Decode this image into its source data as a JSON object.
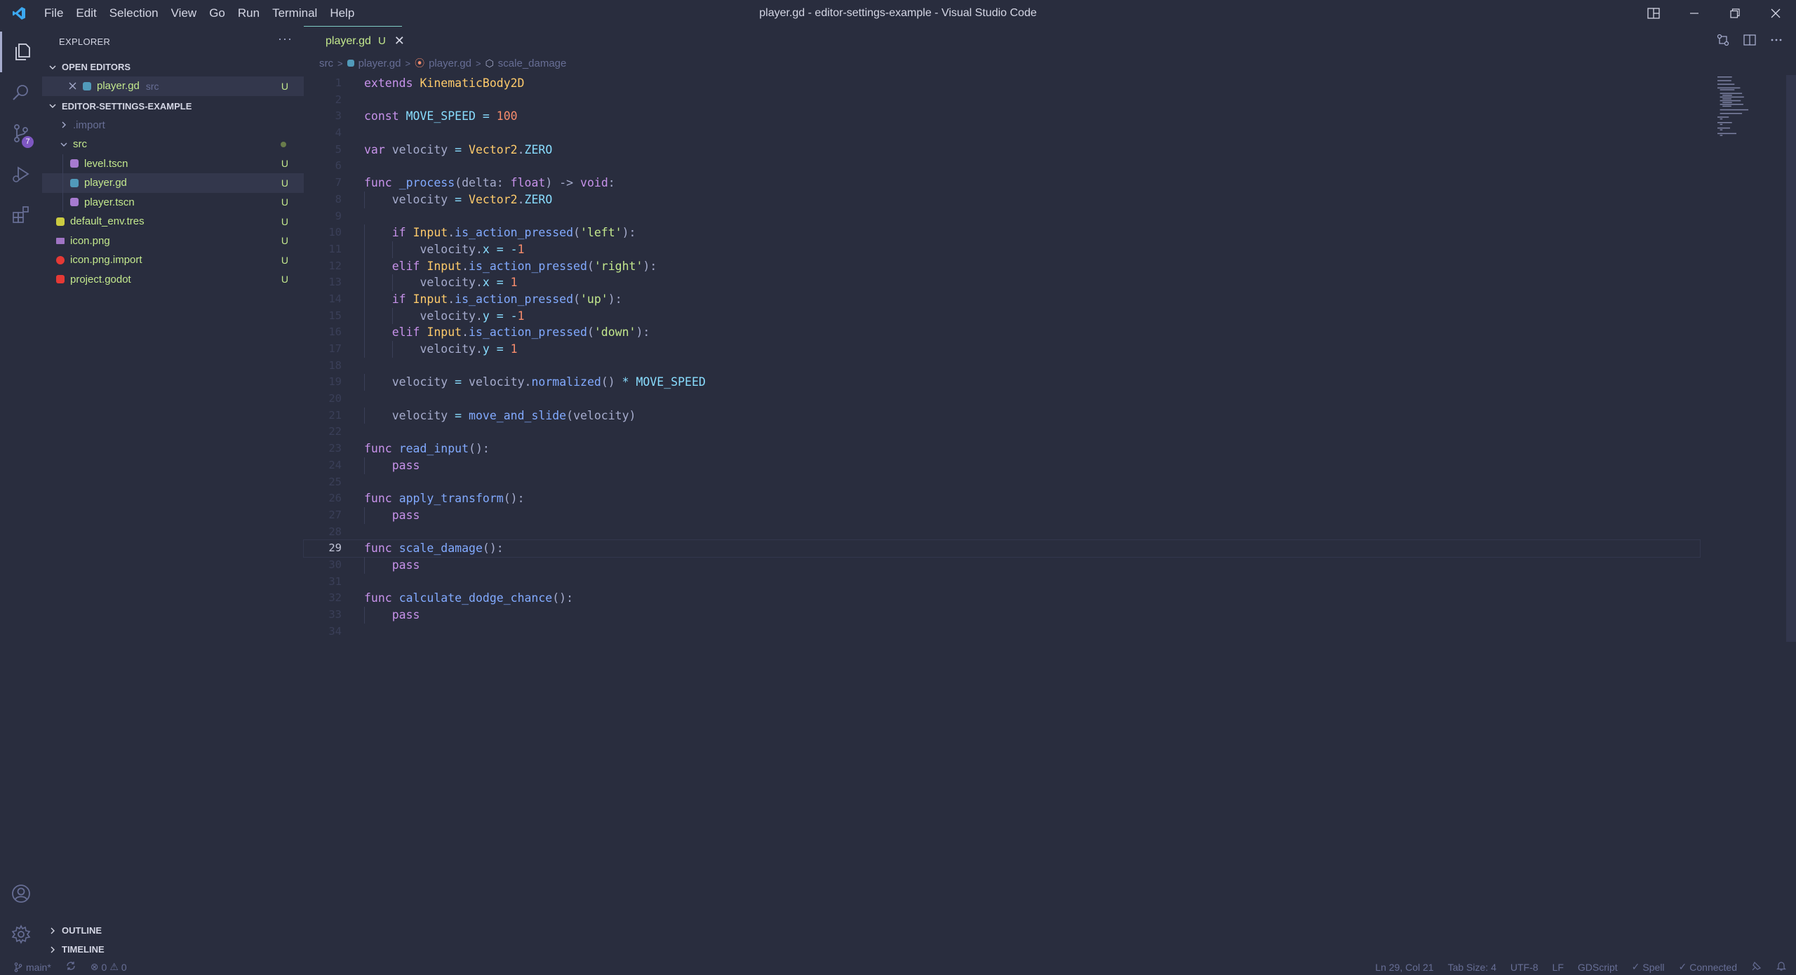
{
  "window": {
    "title": "player.gd - editor-settings-example - Visual Studio Code",
    "menu": [
      "File",
      "Edit",
      "Selection",
      "View",
      "Go",
      "Run",
      "Terminal",
      "Help"
    ]
  },
  "activity": {
    "scm_badge": "7"
  },
  "sidebar": {
    "title": "EXPLORER",
    "more": "···",
    "open_editors_label": "OPEN EDITORS",
    "open_editor": {
      "name": "player.gd",
      "path": "src",
      "status": "U"
    },
    "folder_label": "EDITOR-SETTINGS-EXAMPLE",
    "tree": [
      {
        "name": ".import",
        "type": "folder",
        "status": ""
      },
      {
        "name": "src",
        "type": "folder",
        "status": ""
      },
      {
        "name": "level.tscn",
        "type": "file",
        "status": "U"
      },
      {
        "name": "player.gd",
        "type": "file",
        "status": "U"
      },
      {
        "name": "player.tscn",
        "type": "file",
        "status": "U"
      },
      {
        "name": "default_env.tres",
        "type": "file",
        "status": "U"
      },
      {
        "name": "icon.png",
        "type": "file",
        "status": "U"
      },
      {
        "name": "icon.png.import",
        "type": "file",
        "status": "U"
      },
      {
        "name": "project.godot",
        "type": "file",
        "status": "U"
      }
    ],
    "outline_label": "OUTLINE",
    "timeline_label": "TIMELINE"
  },
  "editor": {
    "tab": {
      "name": "player.gd",
      "status": "U",
      "close": "✕"
    },
    "breadcrumb": [
      "src",
      "player.gd",
      "player.gd",
      "scale_damage"
    ],
    "current_line": 29,
    "lines": [
      "extends KinematicBody2D",
      "",
      "const MOVE_SPEED = 100",
      "",
      "var velocity = Vector2.ZERO",
      "",
      "func _process(delta: float) -> void:",
      "    velocity = Vector2.ZERO",
      "",
      "    if Input.is_action_pressed('left'):",
      "        velocity.x = -1",
      "    elif Input.is_action_pressed('right'):",
      "        velocity.x = 1",
      "    if Input.is_action_pressed('up'):",
      "        velocity.y = -1",
      "    elif Input.is_action_pressed('down'):",
      "        velocity.y = 1",
      "",
      "    velocity = velocity.normalized() * MOVE_SPEED",
      "",
      "    velocity = move_and_slide(velocity)",
      "",
      "func read_input():",
      "    pass",
      "",
      "func apply_transform():",
      "    pass",
      "",
      "func scale_damage():",
      "    pass",
      "",
      "func calculate_dodge_chance():",
      "    pass",
      ""
    ]
  },
  "status": {
    "branch": "main*",
    "errors": "0",
    "warnings": "0",
    "position": "Ln 29, Col 21",
    "tab_size": "Tab Size: 4",
    "encoding": "UTF-8",
    "eol": "LF",
    "language": "GDScript",
    "spell": "Spell",
    "connection": "Connected"
  },
  "colors": {
    "background": "#292d3e",
    "keyword": "#c792ea",
    "function": "#82aaff",
    "class": "#ffcb6b",
    "number": "#f78c6c",
    "string": "#c3e88d",
    "untracked": "#c3e88d"
  }
}
